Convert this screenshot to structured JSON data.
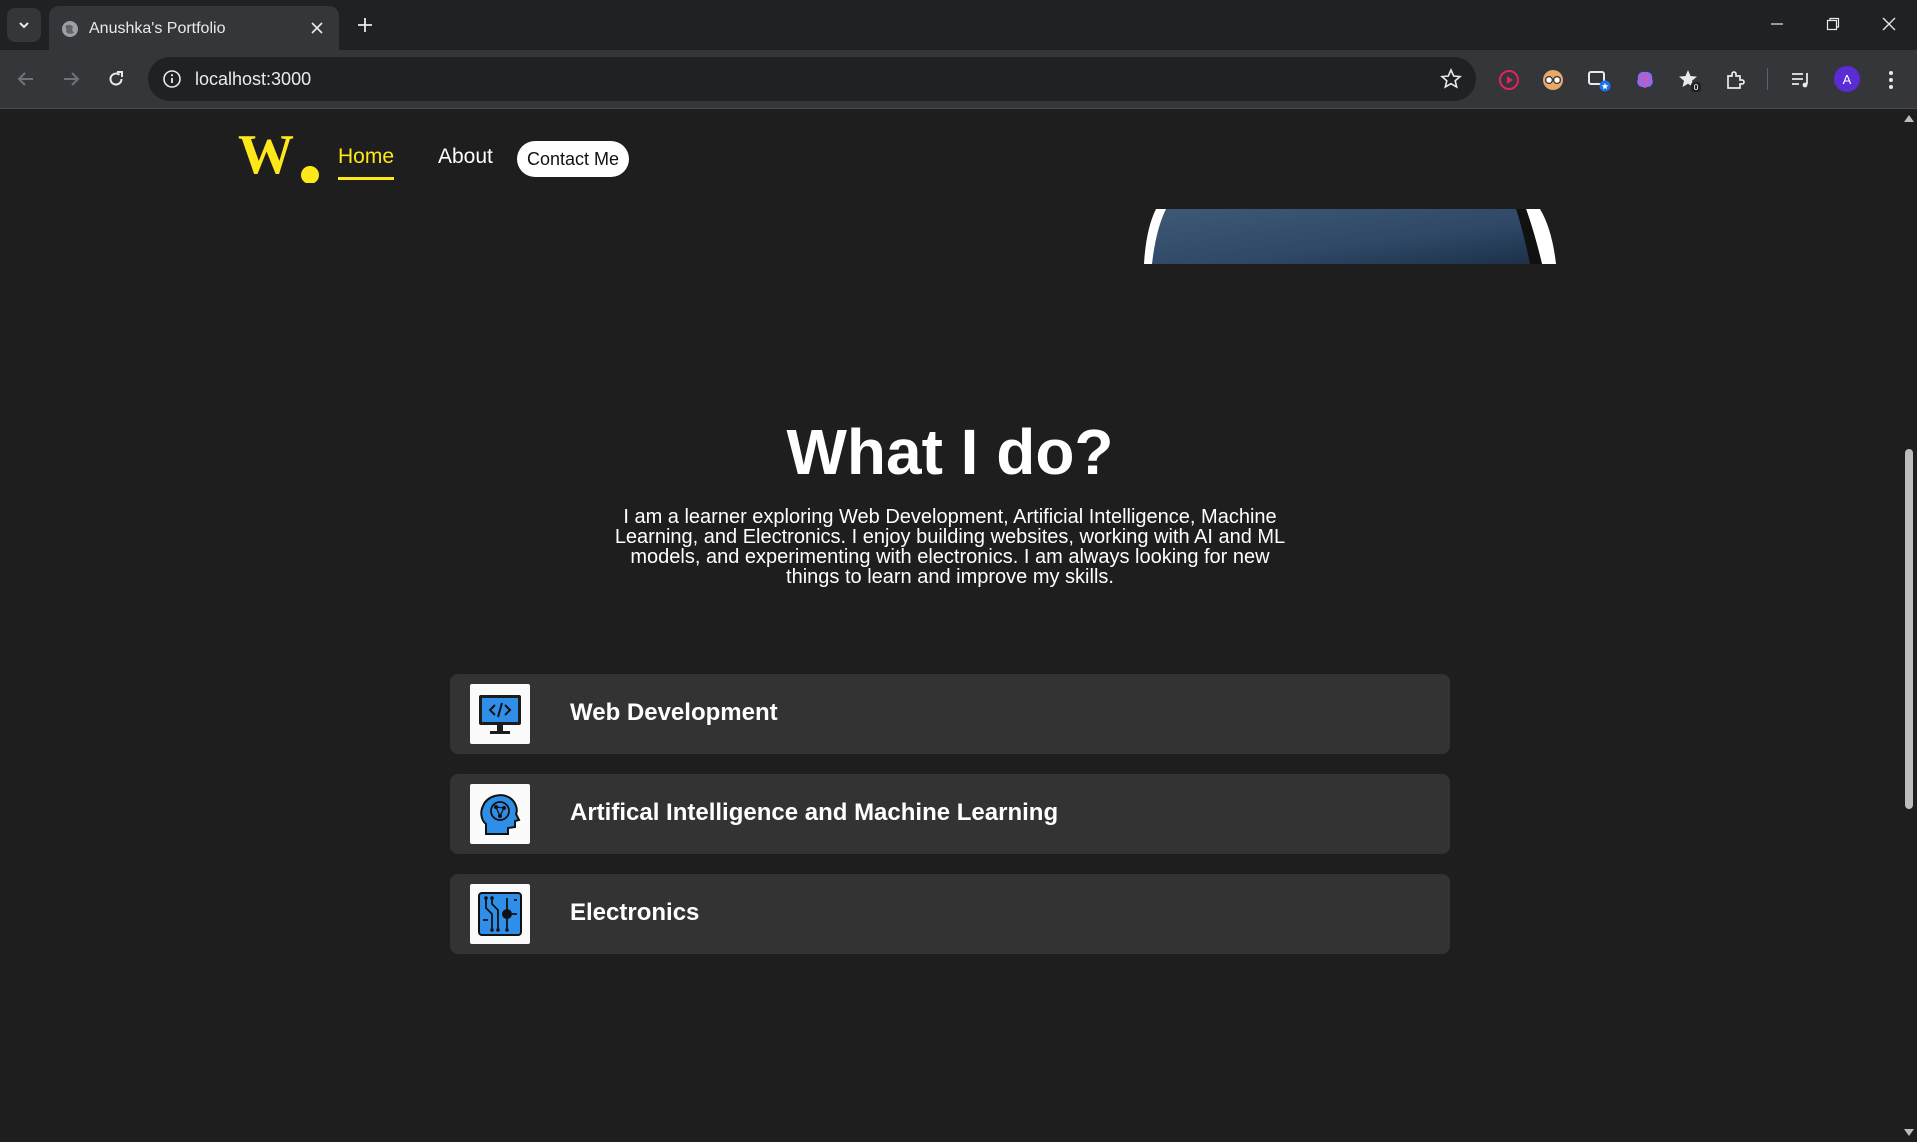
{
  "browser": {
    "tab_title": "Anushka's Portfolio",
    "url": "localhost:3000",
    "profile_initial": "A",
    "extension_badge": "0"
  },
  "nav": {
    "logo_letter": "W",
    "home": "Home",
    "about": "About",
    "contact": "Contact Me"
  },
  "colors": {
    "accent": "#ffe81a",
    "background": "#1e1e1e",
    "card": "#333333",
    "icon_blue": "#2f8fe8"
  },
  "section": {
    "title": "What I do?",
    "intro_lines": [
      "I am a learner exploring Web Development, Artificial Intelligence, Machine",
      "Learning, and Electronics. I enjoy building websites, working with AI and ML",
      "models, and experimenting with electronics. I am always looking for new",
      "things to learn and improve my skills."
    ]
  },
  "services": [
    {
      "label": "Web Development",
      "icon": "monitor-code-icon"
    },
    {
      "label": "Artifical Intelligence and Machine Learning",
      "icon": "ai-head-icon"
    },
    {
      "label": "Electronics",
      "icon": "circuit-chip-icon"
    }
  ]
}
